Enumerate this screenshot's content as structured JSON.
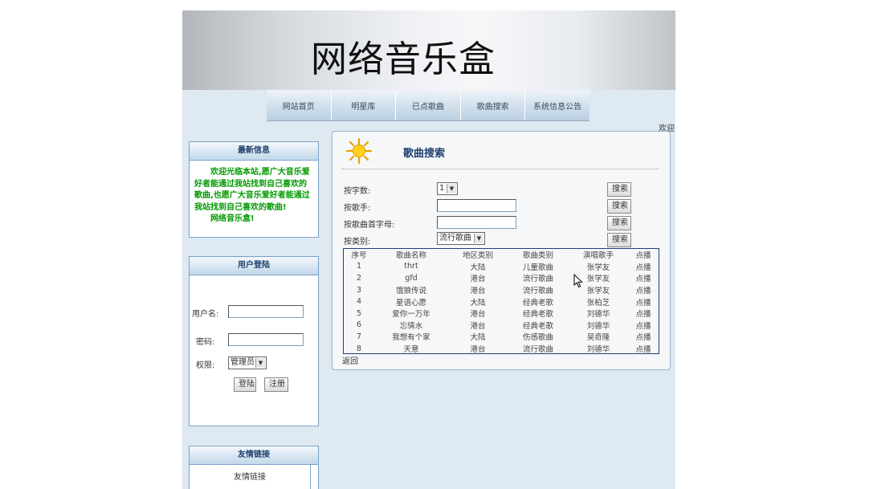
{
  "header": {
    "title": "网络音乐盒"
  },
  "nav": {
    "items": [
      {
        "label": "网站首页"
      },
      {
        "label": "明星库"
      },
      {
        "label": "已点歌曲"
      },
      {
        "label": "歌曲搜索"
      },
      {
        "label": "系统信息公告"
      }
    ]
  },
  "welcome_text": "欢迎:",
  "sidebar": {
    "news": {
      "title": "最新信息",
      "paragraph1": "欢迎光临本站,愿广大音乐爱好者能通过我站找到自己喜欢的歌曲,也愿广大音乐爱好者能通过我站找到自己喜欢的歌曲!",
      "paragraph2": "网络音乐盒!"
    },
    "login": {
      "title": "用户登陆",
      "username_label": "用户名:",
      "username_value": "",
      "password_label": "密码:",
      "password_value": "",
      "role_label": "权限:",
      "role_selected": "管理员",
      "login_button": "登陆",
      "register_button": "注册"
    },
    "links": {
      "title": "友情链接",
      "item": "友情链接"
    }
  },
  "main": {
    "title": "歌曲搜索",
    "search_rows": [
      {
        "label": "按字数:",
        "control": "select",
        "value": "1",
        "button": "搜索"
      },
      {
        "label": "按歌手:",
        "control": "input",
        "value": "",
        "button": "搜索"
      },
      {
        "label": "按歌曲首字母:",
        "control": "input",
        "value": "",
        "button": "搜索"
      },
      {
        "label": "按类别:",
        "control": "select",
        "value": "流行歌曲",
        "button": "搜索"
      }
    ],
    "table": {
      "columns": [
        "序号",
        "歌曲名称",
        "地区类别",
        "歌曲类别",
        "演唱歌手",
        "点播"
      ],
      "rows": [
        [
          "1",
          "thrt",
          "大陆",
          "儿童歌曲",
          "张学友",
          "点播"
        ],
        [
          "2",
          "gfd",
          "港台",
          "流行歌曲",
          "张学友",
          "点播"
        ],
        [
          "3",
          "饿狼传说",
          "港台",
          "流行歌曲",
          "张学友",
          "点播"
        ],
        [
          "4",
          "星语心愿",
          "大陆",
          "经典老歌",
          "张柏芝",
          "点播"
        ],
        [
          "5",
          "爱你一万年",
          "港台",
          "经典老歌",
          "刘德华",
          "点播"
        ],
        [
          "6",
          "忘情水",
          "港台",
          "经典老歌",
          "刘德华",
          "点播"
        ],
        [
          "7",
          "我想有个家",
          "大陆",
          "伤感歌曲",
          "吴奇隆",
          "点播"
        ],
        [
          "8",
          "天意",
          "港台",
          "流行歌曲",
          "刘德华",
          "点播"
        ]
      ]
    },
    "back_link": "返回"
  }
}
